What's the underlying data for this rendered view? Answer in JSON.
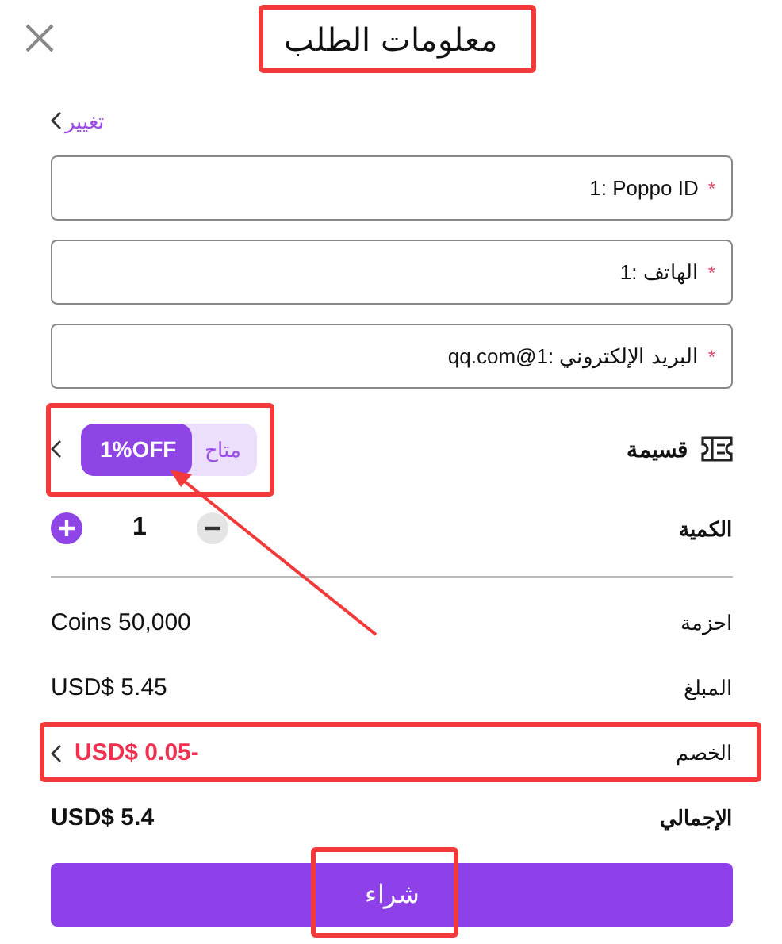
{
  "header": {
    "title": "معلومات الطلب",
    "title_highlighted": true
  },
  "change_link": "تغيير",
  "fields": [
    {
      "value": "1:  Poppo ID",
      "required_mark": "*"
    },
    {
      "value": "1:  الهاتف",
      "required_mark": "*"
    },
    {
      "value": "qq.com@1:  البريد الإلكتروني",
      "required_mark": "*"
    }
  ],
  "coupon": {
    "label": "قسيمة",
    "discount": "1%OFF",
    "status": "متاح",
    "highlighted": true
  },
  "quantity": {
    "label": "الكمية",
    "value": "1"
  },
  "summary": [
    {
      "label": "احزمة",
      "value": "Coins 50,000",
      "kind": "plain",
      "highlighted": false
    },
    {
      "label": "المبلغ",
      "value": "USD$ 5.45",
      "kind": "plain",
      "highlighted": false
    },
    {
      "label": "الخصم",
      "value": "USD$ 0.05-",
      "kind": "discount",
      "highlighted": true
    },
    {
      "label": "الإجمالي",
      "value": "USD$ 5.4",
      "kind": "total",
      "highlighted": false
    }
  ],
  "buy_button": {
    "label": "شراء",
    "highlighted": true
  }
}
